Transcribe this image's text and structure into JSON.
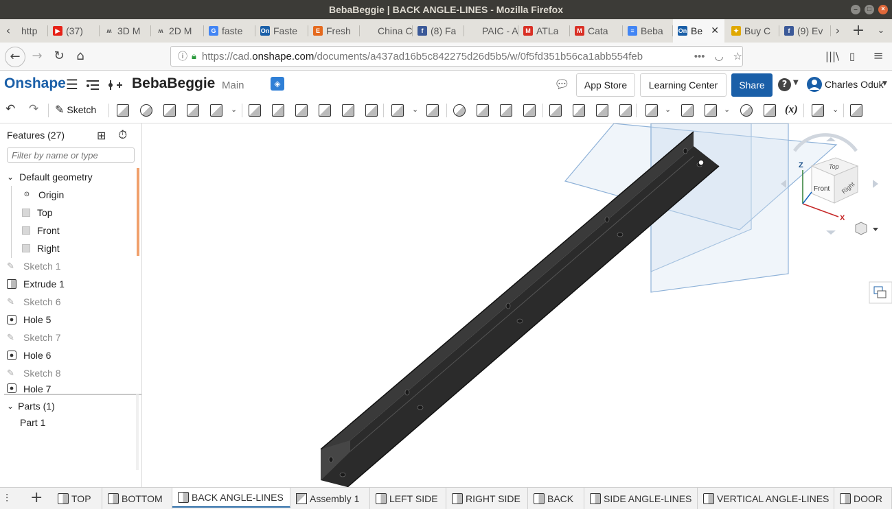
{
  "window": {
    "title": "BebaBeggie | BACK ANGLE-LINES - Mozilla Firefox"
  },
  "browser_tabs": [
    {
      "label": "http",
      "icon": "page-icon",
      "color": "#888888"
    },
    {
      "label": "(37)",
      "icon": "youtube-icon",
      "color": "#e62117"
    },
    {
      "label": "3D M",
      "icon": "bookmark-icon",
      "color": "#555555"
    },
    {
      "label": "2D M",
      "icon": "bookmark-icon",
      "color": "#555555"
    },
    {
      "label": "faste",
      "icon": "google-icon",
      "color": "#4285f4"
    },
    {
      "label": "Faste",
      "icon": "onshape-icon",
      "color": "#1a5fa8"
    },
    {
      "label": "Fresh",
      "icon": "etsy-icon",
      "color": "#e56a1e"
    },
    {
      "label": "China Co",
      "icon": "page-icon",
      "color": "#888888"
    },
    {
      "label": "(8) Fa",
      "icon": "facebook-icon",
      "color": "#3b5998"
    },
    {
      "label": "PAIC - Au",
      "icon": "page-icon",
      "color": "#888888"
    },
    {
      "label": "ATLa",
      "icon": "gmail-icon",
      "color": "#d93025"
    },
    {
      "label": "Cata",
      "icon": "gmail-icon",
      "color": "#d93025"
    },
    {
      "label": "Beba",
      "icon": "docs-icon",
      "color": "#4285f4"
    },
    {
      "label": "Be",
      "icon": "onshape-icon",
      "color": "#1a5fa8",
      "active": true
    },
    {
      "label": "Buy C",
      "icon": "bulb-icon",
      "color": "#e0a800"
    },
    {
      "label": "(9) Ev",
      "icon": "facebook-icon",
      "color": "#3b5998"
    }
  ],
  "url": {
    "prefix": "https://cad.",
    "host": "onshape.com",
    "path": "/documents/a437ad16b5c842275d26d5b5/w/0f5fd351b56ca1abb554feb"
  },
  "onshape": {
    "logo": "Onshape",
    "doc_name": "BebaBeggie",
    "branch": "Main",
    "app_store": "App Store",
    "learning_center": "Learning Center",
    "share": "Share",
    "help": "?",
    "user": "Charles Oduk",
    "accent": "#1a5fa8"
  },
  "toolbar": {
    "sketch_label": "Sketch",
    "variable_label": "(x)"
  },
  "feature_tree": {
    "header": "Features (27)",
    "filter_placeholder": "Filter by name or type",
    "default_geometry": "Default geometry",
    "geometry_items": [
      "Origin",
      "Top",
      "Front",
      "Right"
    ],
    "features": [
      {
        "label": "Sketch 1",
        "type": "sketch"
      },
      {
        "label": "Extrude 1",
        "type": "extrude"
      },
      {
        "label": "Sketch 6",
        "type": "sketch"
      },
      {
        "label": "Hole 5",
        "type": "hole"
      },
      {
        "label": "Sketch 7",
        "type": "sketch"
      },
      {
        "label": "Hole 6",
        "type": "hole"
      },
      {
        "label": "Sketch 8",
        "type": "sketch"
      },
      {
        "label": "Hole 7",
        "type": "hole"
      }
    ],
    "parts_header": "Parts (1)",
    "parts": [
      "Part 1"
    ]
  },
  "viewcube": {
    "top": "Top",
    "front": "Front",
    "right": "Right",
    "z": "Z",
    "x": "X"
  },
  "bottom_tabs": [
    {
      "label": "TOP",
      "type": "part-studio"
    },
    {
      "label": "BOTTOM",
      "type": "part-studio"
    },
    {
      "label": "BACK ANGLE-LINES",
      "type": "part-studio",
      "active": true
    },
    {
      "label": "Assembly 1",
      "type": "assembly"
    },
    {
      "label": "LEFT SIDE",
      "type": "part-studio"
    },
    {
      "label": "RIGHT SIDE",
      "type": "part-studio"
    },
    {
      "label": "BACK",
      "type": "part-studio"
    },
    {
      "label": "SIDE ANGLE-LINES",
      "type": "part-studio"
    },
    {
      "label": "VERTICAL ANGLE-LINES",
      "type": "part-studio"
    },
    {
      "label": "DOOR",
      "type": "part-studio"
    }
  ]
}
